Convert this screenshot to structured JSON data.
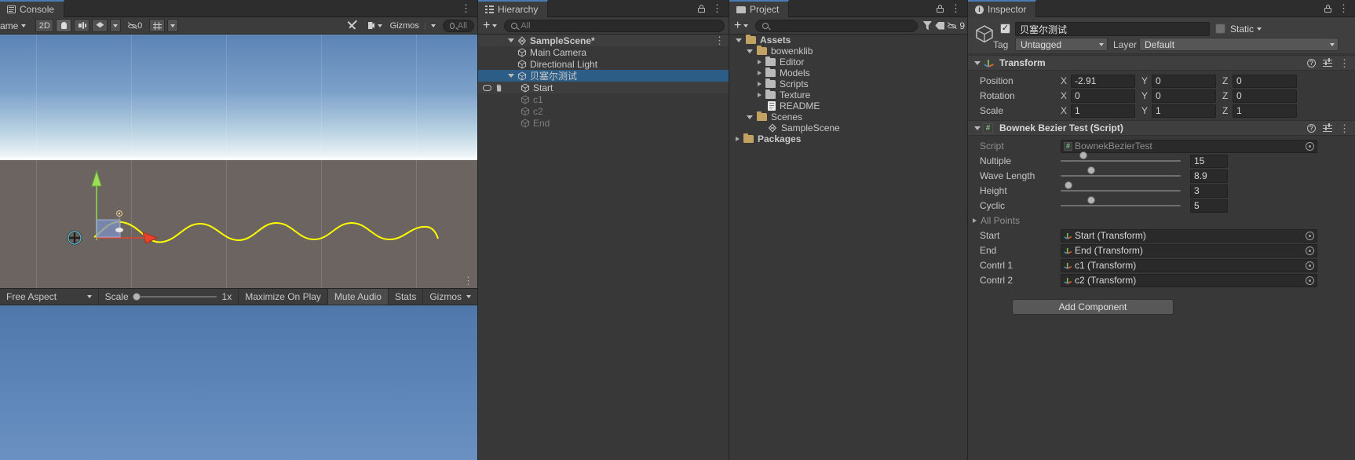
{
  "scene_panel": {
    "tab_label": "Console",
    "tab_icon": "console-icon",
    "toolbar": {
      "view_mode": "ame",
      "mode_2d": "2D",
      "lighting_icon": "lightbulb-icon",
      "audio_icon": "audio-icon",
      "fx_icon": "fx-icon",
      "hidden_count": "0",
      "hidden_icon": "eye-slash-icon",
      "grid_icon": "grid-icon",
      "tools_icon": "tools-icon",
      "camera_icon": "camera-icon",
      "gizmos_label": "Gizmos",
      "search_placeholder": "All",
      "search_icon": "search-icon"
    },
    "overflow_icon": "kebab-menu-icon"
  },
  "game_panel": {
    "aspect_label": "Free Aspect",
    "scale_label": "Scale",
    "scale_value": "1x",
    "maximize_label": "Maximize On Play",
    "mute_label": "Mute Audio",
    "stats_label": "Stats",
    "gizmos_label": "Gizmos",
    "overflow_icon": "kebab-menu-icon"
  },
  "hierarchy": {
    "tab_label": "Hierarchy",
    "tab_icon": "hierarchy-icon",
    "lock_icon": "lock-icon",
    "overflow_icon": "kebab-menu-icon",
    "add_label": "+",
    "search_placeholder": "All",
    "search_icon": "search-icon",
    "rows": [
      {
        "label": "SampleScene*",
        "icon": "unity-scene-icon",
        "indent": 14,
        "expander": "down",
        "bold": true,
        "state": "alt",
        "kebab": true
      },
      {
        "label": "Main Camera",
        "icon": "cube-icon",
        "indent": 28,
        "expander": "none",
        "bold": false,
        "state": "normal",
        "kebab": false
      },
      {
        "label": "Directional Light",
        "icon": "cube-icon",
        "indent": 28,
        "expander": "none",
        "bold": false,
        "state": "normal",
        "kebab": false
      },
      {
        "label": "贝塞尔测试",
        "icon": "cube-icon",
        "indent": 28,
        "expander": "down",
        "bold": false,
        "state": "selected",
        "kebab": false
      },
      {
        "label": "Start",
        "icon": "cube-icon",
        "indent": 42,
        "expander": "none",
        "bold": false,
        "state": "alt",
        "kebab": false,
        "visibility": true
      },
      {
        "label": "c1",
        "icon": "cube-icon",
        "indent": 42,
        "expander": "none",
        "bold": false,
        "state": "dim",
        "kebab": false
      },
      {
        "label": "c2",
        "icon": "cube-icon",
        "indent": 42,
        "expander": "none",
        "bold": false,
        "state": "dim",
        "kebab": false
      },
      {
        "label": "End",
        "icon": "cube-icon",
        "indent": 42,
        "expander": "none",
        "bold": false,
        "state": "dim",
        "kebab": false
      }
    ]
  },
  "project": {
    "tab_label": "Project",
    "tab_icon": "folder-icon",
    "lock_icon": "lock-icon",
    "overflow_icon": "kebab-menu-icon",
    "add_label": "+",
    "search_placeholder": "",
    "search_icon": "search-icon",
    "toolbar_icons": [
      "asset-filter-icon",
      "label-filter-icon",
      "hidden-packages-icon"
    ],
    "hidden_count": "9",
    "rows": [
      {
        "label": "Assets",
        "icon": "folder-open-icon",
        "indent": 8,
        "expander": "down",
        "bold": true
      },
      {
        "label": "bowenklib",
        "icon": "folder-open-icon",
        "indent": 22,
        "expander": "down",
        "bold": false
      },
      {
        "label": "Editor",
        "icon": "folder-icon",
        "indent": 36,
        "expander": "right",
        "bold": false
      },
      {
        "label": "Models",
        "icon": "folder-icon",
        "indent": 36,
        "expander": "right",
        "bold": false
      },
      {
        "label": "Scripts",
        "icon": "folder-icon",
        "indent": 36,
        "expander": "right",
        "bold": false
      },
      {
        "label": "Texture",
        "icon": "folder-icon",
        "indent": 36,
        "expander": "right",
        "bold": false
      },
      {
        "label": "README",
        "icon": "text-file-icon",
        "indent": 36,
        "expander": "none",
        "bold": false
      },
      {
        "label": "Scenes",
        "icon": "folder-open-icon",
        "indent": 22,
        "expander": "down",
        "bold": false
      },
      {
        "label": "SampleScene",
        "icon": "unity-scene-icon",
        "indent": 36,
        "expander": "none",
        "bold": false
      },
      {
        "label": "Packages",
        "icon": "folder-open-icon",
        "indent": 8,
        "expander": "right",
        "bold": true
      }
    ]
  },
  "inspector": {
    "tab_label": "Inspector",
    "tab_icon": "info-icon",
    "lock_icon": "lock-icon",
    "overflow_icon": "kebab-menu-icon",
    "object_icon": "cube-icon",
    "enabled": true,
    "object_name": "贝塞尔测试",
    "static_label": "Static",
    "static_checked": false,
    "tag_label": "Tag",
    "tag_value": "Untagged",
    "layer_label": "Layer",
    "layer_value": "Default",
    "transform": {
      "title": "Transform",
      "icon": "transform-axes-icon",
      "help_icon": "help-icon",
      "preset_icon": "preset-icon",
      "menu_icon": "kebab-menu-icon",
      "rows": [
        {
          "label": "Position",
          "x": "-2.91",
          "y": "0",
          "z": "0"
        },
        {
          "label": "Rotation",
          "x": "0",
          "y": "0",
          "z": "0"
        },
        {
          "label": "Scale",
          "x": "1",
          "y": "1",
          "z": "1"
        }
      ],
      "axes": [
        "X",
        "Y",
        "Z"
      ]
    },
    "script_component": {
      "title": "Bownek Bezier Test (Script)",
      "icon": "cs-script-icon",
      "help_icon": "help-icon",
      "preset_icon": "preset-icon",
      "menu_icon": "kebab-menu-icon",
      "remove_icon": "remove-icon",
      "script_label": "Script",
      "script_value": "BownekBezierTest",
      "sliders": [
        {
          "label": "Nultiple",
          "value": "15",
          "knob_pct": 16
        },
        {
          "label": "Wave Length",
          "value": "8.9",
          "knob_pct": 22
        },
        {
          "label": "Height",
          "value": "3",
          "knob_pct": 3
        },
        {
          "label": "Cyclic",
          "value": "5",
          "knob_pct": 22
        }
      ],
      "all_points_label": "All Points",
      "object_refs": [
        {
          "label": "Start",
          "value": "Start (Transform)"
        },
        {
          "label": "End",
          "value": "End (Transform)"
        },
        {
          "label": "Contrl 1",
          "value": "c1 (Transform)"
        },
        {
          "label": "Contrl 2",
          "value": "c2 (Transform)"
        }
      ]
    },
    "add_component_label": "Add Component"
  },
  "colors": {
    "selection_blue": "#2c5d87",
    "tab_accent": "#4b7bb5",
    "curve_yellow": "#ffff00",
    "axis_green": "#8cd44b",
    "axis_red": "#e8432a"
  }
}
